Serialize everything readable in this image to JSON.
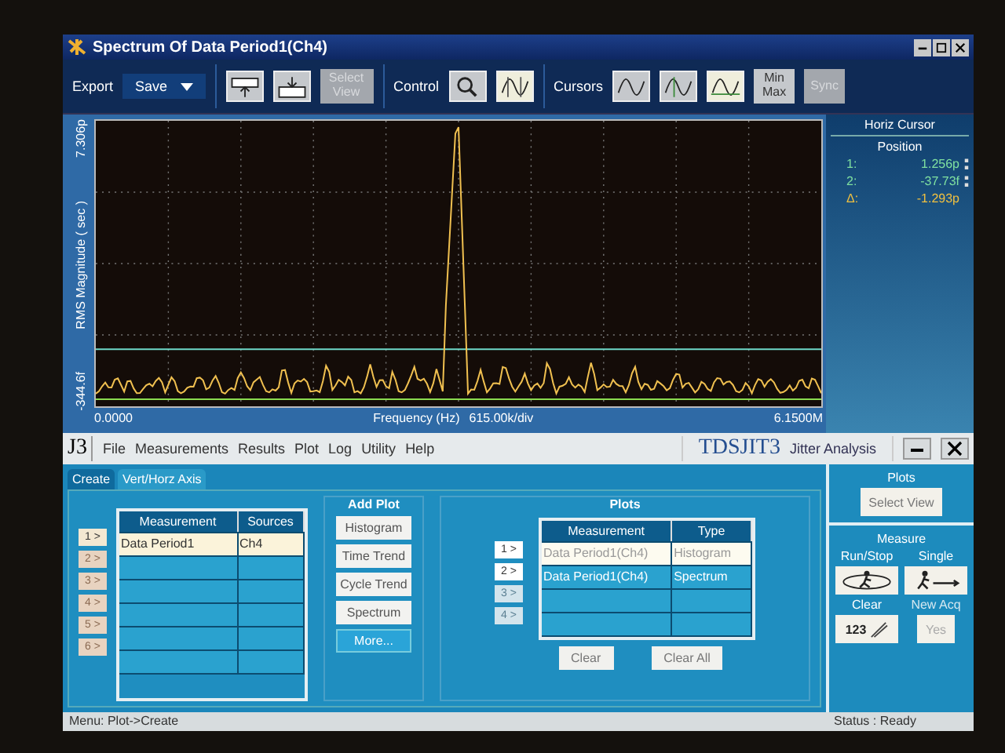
{
  "scope_window": {
    "title": "Spectrum Of Data Period1(Ch4)"
  },
  "toolbar": {
    "export_label": "Export",
    "export_value": "Save",
    "select_view": {
      "label": "Select View",
      "disabled": true
    },
    "control_label": "Control",
    "control_tools": [
      {
        "kind": "zoom",
        "selected": false
      },
      {
        "kind": "cursor",
        "selected": true
      }
    ],
    "cursors_label": "Cursors",
    "cursor_modes": [
      {
        "kind": "wave",
        "selected": false
      },
      {
        "kind": "vertical",
        "selected": false
      },
      {
        "kind": "horizontal",
        "selected": true
      }
    ],
    "min_max": {
      "label": "Min Max",
      "disabled": false
    },
    "sync": {
      "label": "Sync",
      "disabled": true
    }
  },
  "plot": {
    "y_label": "RMS Magnitude ( sec )",
    "y_max": "7.306p",
    "y_min": "-344.6f",
    "x_min": "0.0000",
    "x_label": "Frequency (Hz)",
    "x_scale": "615.00k/div",
    "x_max": "6.1500M"
  },
  "cursor_panel": {
    "title": "Horiz Cursor",
    "subtitle": "Position",
    "readouts": [
      {
        "label": "1:",
        "value": "1.256p",
        "kind": "cursor",
        "color": "#7fe0a0"
      },
      {
        "label": "2:",
        "value": "-37.73f",
        "kind": "cursor",
        "color": "#7fe0a0"
      },
      {
        "label": "Δ:",
        "value": "-1.293p",
        "kind": "delta",
        "color": "#f0c040"
      }
    ]
  },
  "app": {
    "logo": "J3",
    "menu": [
      "File",
      "Measurements",
      "Results",
      "Plot",
      "Log",
      "Utility",
      "Help"
    ],
    "product": "TDSJIT3",
    "product_subtitle": "Jitter Analysis",
    "tabs": [
      {
        "label": "Create",
        "selected": true
      },
      {
        "label": "Vert/Horz Axis",
        "selected": false
      }
    ],
    "measurements": {
      "columns": [
        "Measurement",
        "Sources"
      ],
      "rows": [
        {
          "index": "1 >",
          "disabled": false,
          "selected": true,
          "cells": [
            "Data Period1",
            "Ch4"
          ]
        },
        {
          "index": "2 >",
          "disabled": true,
          "selected": false
        },
        {
          "index": "3 >",
          "disabled": true,
          "selected": false
        },
        {
          "index": "4 >",
          "disabled": true,
          "selected": false
        },
        {
          "index": "5 >",
          "disabled": true,
          "selected": false
        },
        {
          "index": "6 >",
          "disabled": true,
          "selected": false
        }
      ]
    },
    "add_plot": {
      "title": "Add Plot",
      "buttons": [
        {
          "label": "Histogram",
          "selected": false
        },
        {
          "label": "Time Trend",
          "selected": false
        },
        {
          "label": "Cycle Trend",
          "selected": false
        },
        {
          "label": "Spectrum",
          "selected": false
        },
        {
          "label": "More...",
          "selected": true
        }
      ]
    },
    "plots": {
      "title": "Plots",
      "columns": [
        "Measurement",
        "Type"
      ],
      "rows": [
        {
          "index": "1 >",
          "disabled": false,
          "selected": true,
          "cells": [
            "Data Period1(Ch4)",
            "Histogram"
          ]
        },
        {
          "index": "2 >",
          "disabled": false,
          "selected": false,
          "cells": [
            "Data Period1(Ch4)",
            "Spectrum"
          ]
        },
        {
          "index": "3 >",
          "disabled": true,
          "selected": false
        },
        {
          "index": "4 >",
          "disabled": true,
          "selected": false
        }
      ],
      "clear": "Clear",
      "clear_all": "Clear All"
    },
    "side": {
      "plots_title": "Plots",
      "select_view": "Select View",
      "measure_title": "Measure",
      "run_stop": "Run/Stop",
      "single": "Single",
      "clear": "Clear",
      "clear_digits": "123",
      "new_acq": "New Acq",
      "yes": {
        "label": "Yes",
        "disabled": true
      }
    }
  },
  "status_bar": {
    "menu_path": "Menu: Plot->Create",
    "status": "Status : Ready"
  }
}
